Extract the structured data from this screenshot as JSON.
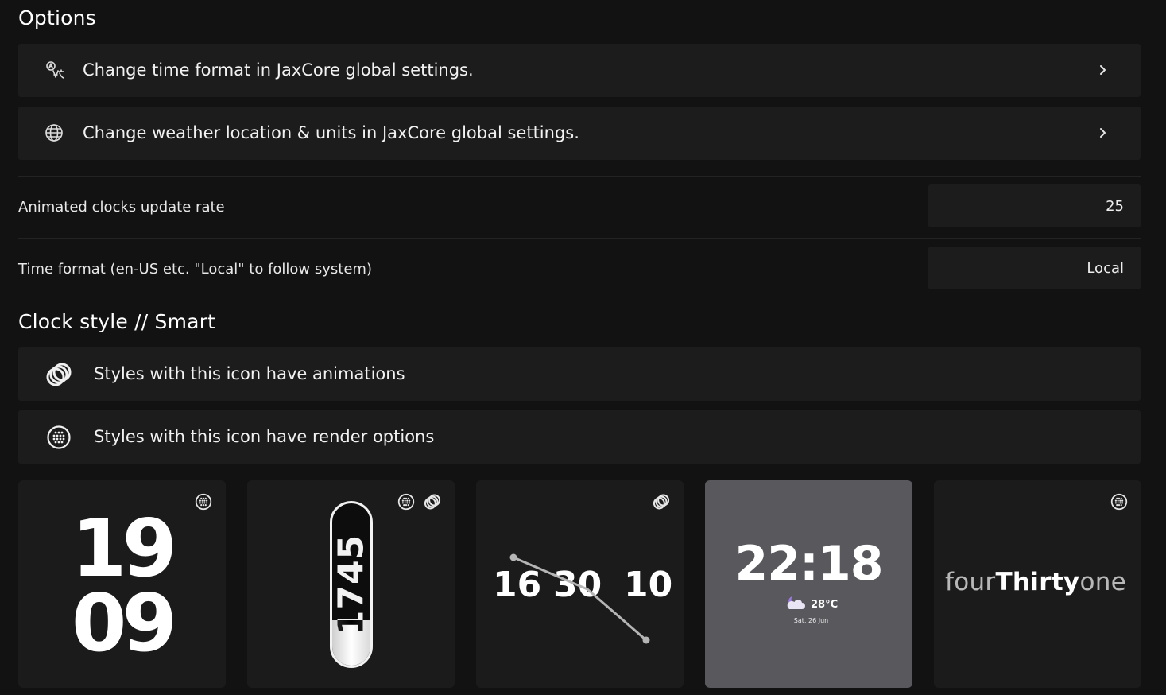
{
  "options": {
    "title": "Options",
    "links": [
      {
        "label": "Change time format in JaxCore global settings.",
        "icon": "translate-icon"
      },
      {
        "label": "Change weather location & units in JaxCore global settings.",
        "icon": "globe-icon"
      }
    ]
  },
  "settings": {
    "update_rate": {
      "label": "Animated clocks update rate",
      "value": "25"
    },
    "time_format": {
      "label": "Time format (en-US etc. \"Local\" to follow system)",
      "value": "Local"
    }
  },
  "clock_style": {
    "title": "Clock style // Smart",
    "legend": [
      {
        "label": "Styles with this icon have animations",
        "icon": "rings-icon"
      },
      {
        "label": "Styles with this icon have render options",
        "icon": "dots-circle-icon"
      }
    ],
    "cards": [
      {
        "top": "19",
        "bottom": "09",
        "badges": [
          "dots-circle-icon"
        ]
      },
      {
        "text": "1745",
        "badges": [
          "dots-circle-icon",
          "rings-icon"
        ]
      },
      {
        "hours": "16",
        "minutes": "30",
        "seconds": "10",
        "badges": [
          "rings-icon"
        ]
      },
      {
        "time": "22:18",
        "temp": "28°C",
        "date": "Sat, 26 Jun",
        "selected": true,
        "badges": []
      },
      {
        "part1": "four",
        "part2": "Thirty",
        "part3": "one",
        "badges": [
          "dots-circle-icon"
        ]
      }
    ]
  },
  "colors": {
    "background": "#121212",
    "row": "#1c1c1c",
    "card": "#1b1b1b",
    "card_selected": "#59585d",
    "accent_cloud": "#9d7be0"
  }
}
